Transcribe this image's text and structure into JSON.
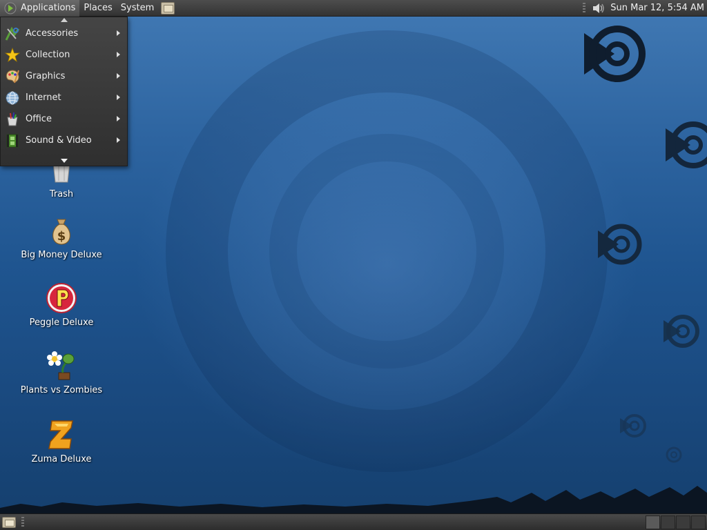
{
  "top_panel": {
    "menus": {
      "applications": "Applications",
      "places": "Places",
      "system": "System"
    },
    "clock": "Sun Mar 12,  5:54 AM"
  },
  "app_menu": {
    "items": [
      {
        "label": "Accessories",
        "icon": "accessories-icon"
      },
      {
        "label": "Collection",
        "icon": "star-icon"
      },
      {
        "label": "Graphics",
        "icon": "palette-icon"
      },
      {
        "label": "Internet",
        "icon": "globe-icon"
      },
      {
        "label": "Office",
        "icon": "office-icon"
      },
      {
        "label": "Sound & Video",
        "icon": "film-icon"
      }
    ]
  },
  "desktop": {
    "icons": [
      {
        "label": "Trash",
        "icon": "trash-icon"
      },
      {
        "label": "Big Money Deluxe",
        "icon": "money-bag-icon"
      },
      {
        "label": "Peggle Deluxe",
        "icon": "peggle-icon"
      },
      {
        "label": "Plants vs Zombies",
        "icon": "plants-vs-zombies-icon"
      },
      {
        "label": "Zuma Deluxe",
        "icon": "zuma-icon"
      }
    ]
  },
  "bottom_panel": {
    "workspace_count": 4
  },
  "colors": {
    "panel": "#3d3d3d",
    "menu": "#3a3a3a",
    "wallpaper": "#1f5590",
    "text": "#f0f0f0"
  }
}
